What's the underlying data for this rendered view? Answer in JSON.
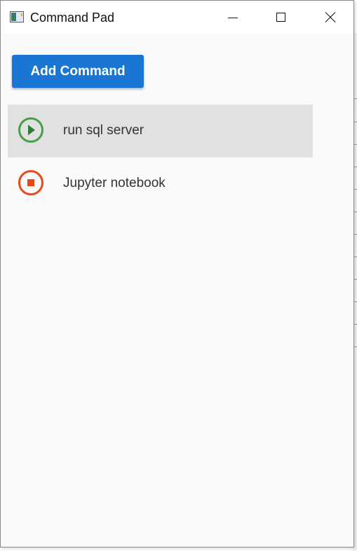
{
  "window": {
    "title": "Command Pad",
    "buttons": [
      "minimize",
      "maximize",
      "close"
    ]
  },
  "toolbar": {
    "add_label": "Add Command",
    "accent": "#1976d2"
  },
  "commands": [
    {
      "label": "run sql server",
      "status": "stopped",
      "action_icon": "play-circle-icon",
      "icon_color": "#43a047",
      "selected": true
    },
    {
      "label": "Jupyter notebook",
      "status": "running",
      "action_icon": "stop-circle-icon",
      "icon_color": "#e64a19",
      "selected": false
    }
  ]
}
